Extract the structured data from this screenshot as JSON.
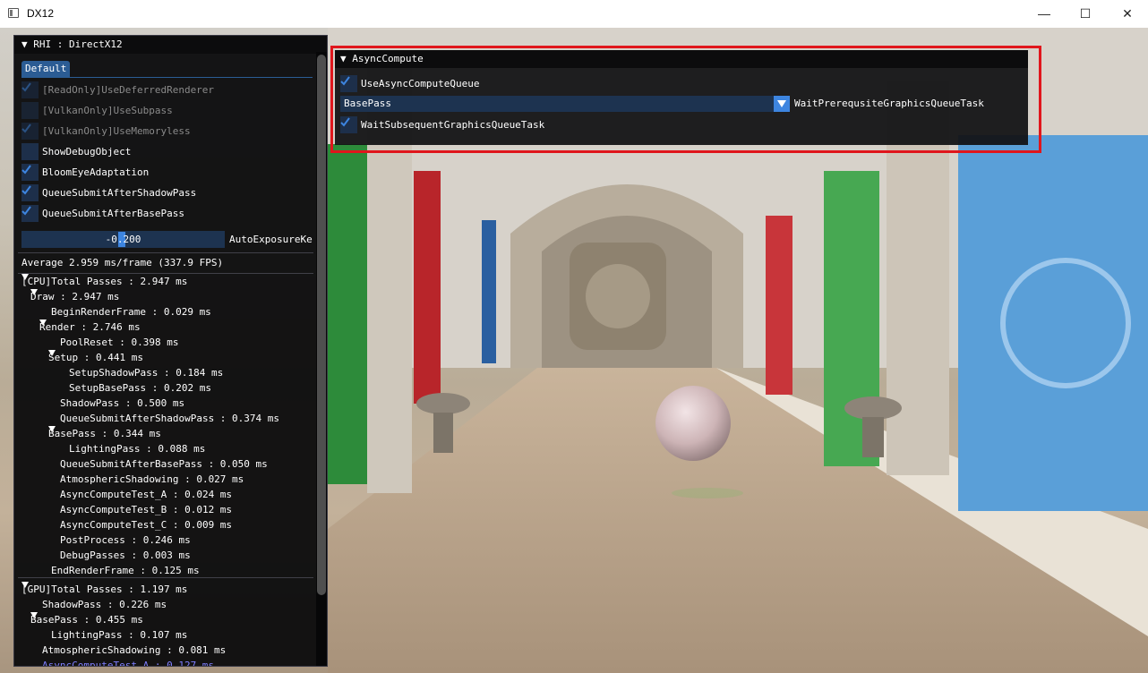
{
  "window": {
    "title": "DX12",
    "minimize_glyph": "—",
    "maximize_glyph": "☐",
    "close_glyph": "✕"
  },
  "left_panel": {
    "header": "▼ RHI : DirectX12",
    "tab": "Default",
    "options": [
      {
        "label": "[ReadOnly]UseDeferredRenderer",
        "checked": true,
        "enabled": false
      },
      {
        "label": "[VulkanOnly]UseSubpass",
        "checked": false,
        "enabled": false
      },
      {
        "label": "[VulkanOnly]UseMemoryless",
        "checked": true,
        "enabled": false
      },
      {
        "label": "ShowDebugObject",
        "checked": false,
        "enabled": true
      },
      {
        "label": "BloomEyeAdaptation",
        "checked": true,
        "enabled": true
      },
      {
        "label": "QueueSubmitAfterShadowPass",
        "checked": true,
        "enabled": true
      },
      {
        "label": "QueueSubmitAfterBasePass",
        "checked": true,
        "enabled": true
      }
    ],
    "slider": {
      "value": "-0.200",
      "label": "AutoExposureKe"
    },
    "average": "Average 2.959 ms/frame (337.9 FPS)",
    "cpu_timings": [
      {
        "level": 0,
        "arrow": true,
        "text": "[CPU]Total Passes : 2.947 ms"
      },
      {
        "level": 1,
        "arrow": true,
        "text": "Draw : 2.947 ms"
      },
      {
        "level": 2,
        "arrow": false,
        "text": "BeginRenderFrame : 0.029 ms"
      },
      {
        "level": 2,
        "arrow": true,
        "text": "Render : 2.746 ms"
      },
      {
        "level": 3,
        "arrow": false,
        "text": "PoolReset : 0.398 ms"
      },
      {
        "level": 3,
        "arrow": true,
        "text": "Setup : 0.441 ms"
      },
      {
        "level": 4,
        "arrow": false,
        "text": "SetupShadowPass : 0.184 ms"
      },
      {
        "level": 4,
        "arrow": false,
        "text": "SetupBasePass : 0.202 ms"
      },
      {
        "level": 3,
        "arrow": false,
        "text": "ShadowPass : 0.500 ms"
      },
      {
        "level": 3,
        "arrow": false,
        "text": "QueueSubmitAfterShadowPass : 0.374 ms"
      },
      {
        "level": 3,
        "arrow": true,
        "text": "BasePass : 0.344 ms"
      },
      {
        "level": 4,
        "arrow": false,
        "text": "LightingPass : 0.088 ms"
      },
      {
        "level": 3,
        "arrow": false,
        "text": "QueueSubmitAfterBasePass : 0.050 ms"
      },
      {
        "level": 3,
        "arrow": false,
        "text": "AtmosphericShadowing : 0.027 ms"
      },
      {
        "level": 3,
        "arrow": false,
        "text": "AsyncComputeTest_A : 0.024 ms"
      },
      {
        "level": 3,
        "arrow": false,
        "text": "AsyncComputeTest_B : 0.012 ms"
      },
      {
        "level": 3,
        "arrow": false,
        "text": "AsyncComputeTest_C : 0.009 ms"
      },
      {
        "level": 3,
        "arrow": false,
        "text": "PostProcess : 0.246 ms"
      },
      {
        "level": 3,
        "arrow": false,
        "text": "DebugPasses : 0.003 ms"
      },
      {
        "level": 2,
        "arrow": false,
        "text": "EndRenderFrame : 0.125 ms"
      }
    ],
    "gpu_timings": [
      {
        "level": 0,
        "arrow": true,
        "text": "[GPU]Total Passes : 1.197 ms"
      },
      {
        "level": 1,
        "arrow": false,
        "text": "ShadowPass : 0.226 ms"
      },
      {
        "level": 1,
        "arrow": true,
        "text": "BasePass : 0.455 ms"
      },
      {
        "level": 2,
        "arrow": false,
        "text": "LightingPass : 0.107 ms"
      },
      {
        "level": 1,
        "arrow": false,
        "text": "AtmosphericShadowing : 0.081 ms"
      },
      {
        "level": 1,
        "arrow": false,
        "text": "AsyncComputeTest_A : 0.127 ms",
        "highlight": true
      }
    ]
  },
  "async_panel": {
    "header": "▼ AsyncCompute",
    "use_async": {
      "label": "UseAsyncComputeQueue",
      "checked": true
    },
    "combo": {
      "value": "BasePass",
      "label": "WaitPrerequsiteGraphicsQueueTask"
    },
    "wait_subsequent": {
      "label": "WaitSubsequentGraphicsQueueTask",
      "checked": true
    }
  },
  "colors": {
    "accent": "#3d85e0",
    "frame_bg": "#1d3350",
    "highlight_box": "#e0161c",
    "highlight_text": "#7f7fff"
  }
}
